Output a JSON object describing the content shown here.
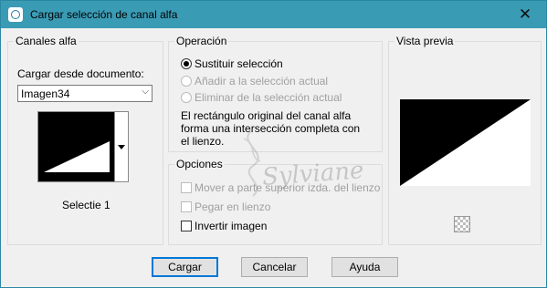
{
  "window": {
    "title": "Cargar selección de canal alfa",
    "close_glyph": "✕"
  },
  "canales": {
    "group_label": "Canales alfa",
    "load_from_label": "Cargar desde documento:",
    "document_value": "Imagen34",
    "channel_name": "Selectie 1"
  },
  "operacion": {
    "group_label": "Operación",
    "options": [
      {
        "label": "Sustituir selección",
        "checked": true,
        "enabled": true
      },
      {
        "label": "Añadir a la selección actual",
        "checked": false,
        "enabled": false
      },
      {
        "label": "Eliminar de la selección actual",
        "checked": false,
        "enabled": false
      }
    ],
    "description_lines": [
      "El rectángulo original del canal alfa",
      "forma una intersección completa con",
      "el lienzo."
    ]
  },
  "opciones": {
    "group_label": "Opciones",
    "items": [
      {
        "label": "Mover a parte superior izda. del lienzo",
        "checked": false,
        "enabled": false
      },
      {
        "label": "Pegar en lienzo",
        "checked": false,
        "enabled": false
      },
      {
        "label": "Invertir imagen",
        "checked": false,
        "enabled": true
      }
    ]
  },
  "preview": {
    "group_label": "Vista previa"
  },
  "buttons": {
    "load": "Cargar",
    "cancel": "Cancelar",
    "help": "Ayuda"
  },
  "watermark": {
    "text": "Sylviane"
  },
  "colors": {
    "titlebar": "#3a9bb5",
    "dialog_bg": "#f0f0f0",
    "default_button_border": "#0078d7"
  }
}
